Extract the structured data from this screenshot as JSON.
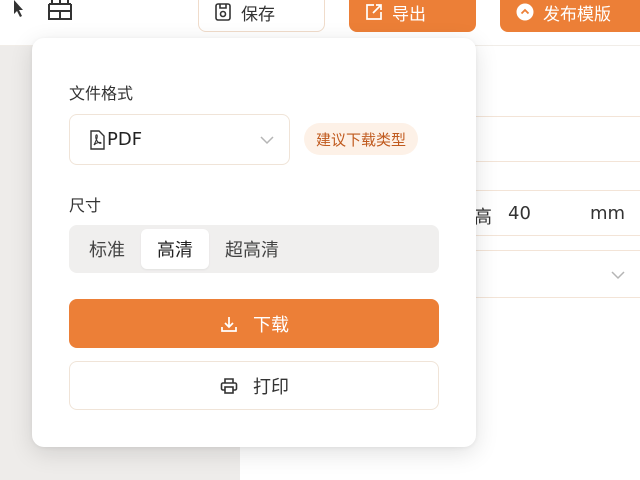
{
  "toolbar": {
    "save_label": "保存",
    "export_label": "导出",
    "publish_label": "发布模版"
  },
  "dimensions": {
    "height_label": "高",
    "height_value": "40",
    "unit": "mm"
  },
  "export_popover": {
    "format_label": "文件格式",
    "format_value": "PDF",
    "recommend_tag": "建议下载类型",
    "size_label": "尺寸",
    "size_options": [
      "标准",
      "高清",
      "超高清"
    ],
    "size_selected": "高清",
    "download_label": "下载",
    "print_label": "打印"
  },
  "colors": {
    "accent": "#ec7f37",
    "tag_bg": "#fdf1e7",
    "tag_text": "#c05a1e"
  }
}
